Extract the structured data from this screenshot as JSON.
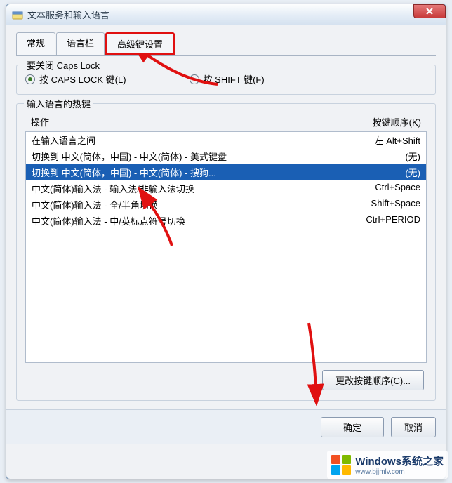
{
  "window": {
    "title": "文本服务和输入语言"
  },
  "tabs": [
    {
      "label": "常规"
    },
    {
      "label": "语言栏"
    },
    {
      "label": "高级键设置"
    }
  ],
  "capslock": {
    "legend": "要关闭 Caps Lock",
    "opt1": "按 CAPS LOCK 键(L)",
    "opt2": "按 SHIFT 键(F)"
  },
  "hotkeys": {
    "legend": "输入语言的热键",
    "col_action": "操作",
    "col_keys": "按键顺序(K)",
    "rows": [
      {
        "action": "在输入语言之间",
        "keys": "左 Alt+Shift"
      },
      {
        "action": "切换到 中文(简体，中国) - 中文(简体) - 美式键盘",
        "keys": "(无)"
      },
      {
        "action": "切换到 中文(简体，中国) - 中文(简体) - 搜狗...",
        "keys": "(无)"
      },
      {
        "action": "中文(简体)输入法 - 输入法/非输入法切换",
        "keys": "Ctrl+Space"
      },
      {
        "action": "中文(简体)输入法 - 全/半角切换",
        "keys": "Shift+Space"
      },
      {
        "action": "中文(简体)输入法 - 中/英标点符号切换",
        "keys": "Ctrl+PERIOD"
      }
    ],
    "change_btn": "更改按键顺序(C)..."
  },
  "dialog": {
    "ok": "确定",
    "cancel": "取消"
  },
  "watermark": {
    "line1": "Windows系统之家",
    "line2": "www.bjjmlv.com"
  }
}
